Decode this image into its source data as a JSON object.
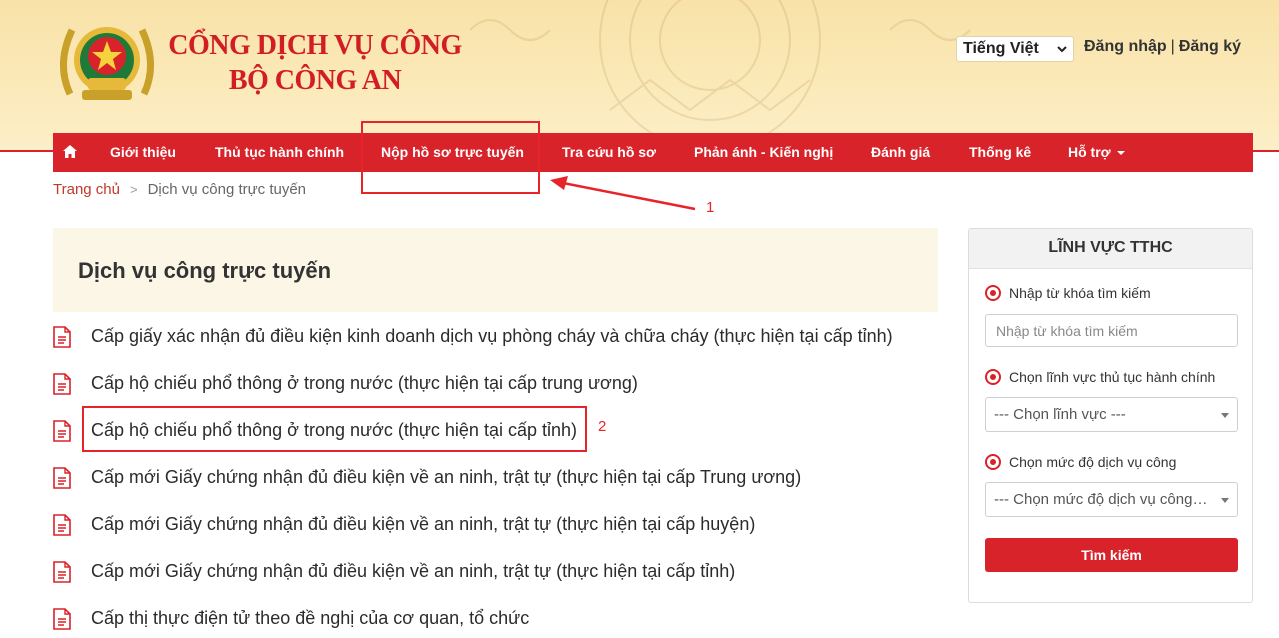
{
  "header": {
    "title_line1": "CỔNG DỊCH VỤ CÔNG",
    "title_line2": "BỘ CÔNG AN",
    "language_selected": "Tiếng Việt",
    "login_label": "Đăng nhập",
    "auth_separator": "|",
    "register_label": "Đăng ký"
  },
  "nav": {
    "home_icon": "home-icon",
    "items": [
      {
        "label": "Giới thiệu"
      },
      {
        "label": "Thủ tục hành chính"
      },
      {
        "label": "Nộp hồ sơ trực tuyến"
      },
      {
        "label": "Tra cứu hồ sơ"
      },
      {
        "label": "Phản ánh - Kiến nghị"
      },
      {
        "label": "Đánh giá"
      },
      {
        "label": "Thống kê"
      },
      {
        "label": "Hỗ trợ"
      }
    ]
  },
  "breadcrumb": {
    "home": "Trang chủ",
    "separator": ">",
    "current": "Dịch vụ công trực tuyến"
  },
  "main": {
    "title": "Dịch vụ công trực tuyến",
    "services": [
      {
        "label": "Cấp giấy xác nhận đủ điều kiện kinh doanh dịch vụ phòng cháy và chữa cháy (thực hiện tại cấp tỉnh)"
      },
      {
        "label": "Cấp hộ chiếu phổ thông ở trong nước (thực hiện tại cấp trung ương)"
      },
      {
        "label": "Cấp hộ chiếu phổ thông ở trong nước (thực hiện tại cấp tỉnh)"
      },
      {
        "label": "Cấp mới Giấy chứng nhận đủ điều kiện về an ninh, trật tự (thực hiện tại cấp Trung ương)"
      },
      {
        "label": "Cấp mới Giấy chứng nhận đủ điều kiện về an ninh, trật tự (thực hiện tại cấp huyện)"
      },
      {
        "label": "Cấp mới Giấy chứng nhận đủ điều kiện về an ninh, trật tự (thực hiện tại cấp tỉnh)"
      },
      {
        "label": "Cấp thị thực điện tử theo đề nghị của cơ quan, tổ chức"
      }
    ]
  },
  "sidebar": {
    "title": "LĨNH VỰC TTHC",
    "keyword_label": "Nhập từ khóa tìm kiếm",
    "keyword_placeholder": "Nhập từ khóa tìm kiếm",
    "field_label": "Chọn lĩnh vực thủ tục hành chính",
    "field_selected": "--- Chọn lĩnh vực ---",
    "level_label": "Chọn mức độ dịch vụ công",
    "level_selected": "--- Chọn mức độ dịch vụ công ---",
    "search_button": "Tìm kiếm"
  },
  "annotations": {
    "label_1": "1",
    "label_2": "2"
  },
  "colors": {
    "brand_red": "#d8232a",
    "header_bg": "#f8e2a8",
    "annotation_red": "#e8242b"
  }
}
